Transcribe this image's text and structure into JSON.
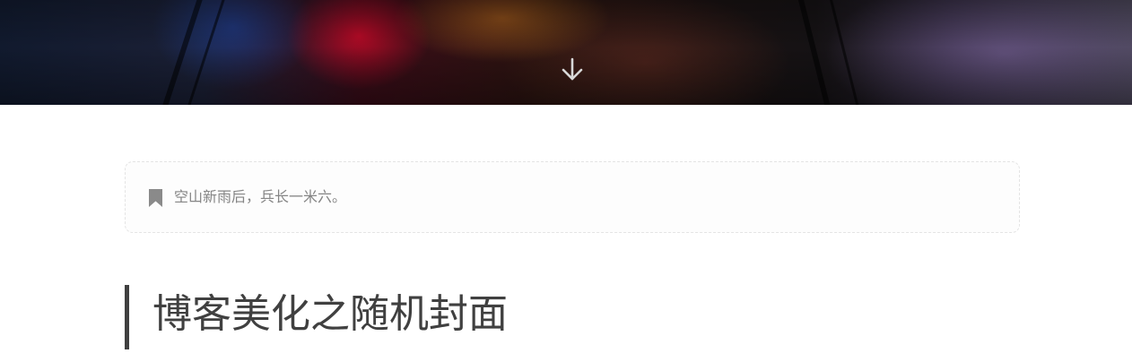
{
  "hero": {
    "scroll_icon": "arrow-down-icon"
  },
  "motto": {
    "icon": "bookmark-icon",
    "text": "空山新雨后，兵长一米六。"
  },
  "post": {
    "title": "博客美化之随机封面"
  },
  "colors": {
    "title_text": "#404040",
    "title_bar": "#404040",
    "motto_text": "#858585",
    "motto_border": "#e4e4e4"
  }
}
